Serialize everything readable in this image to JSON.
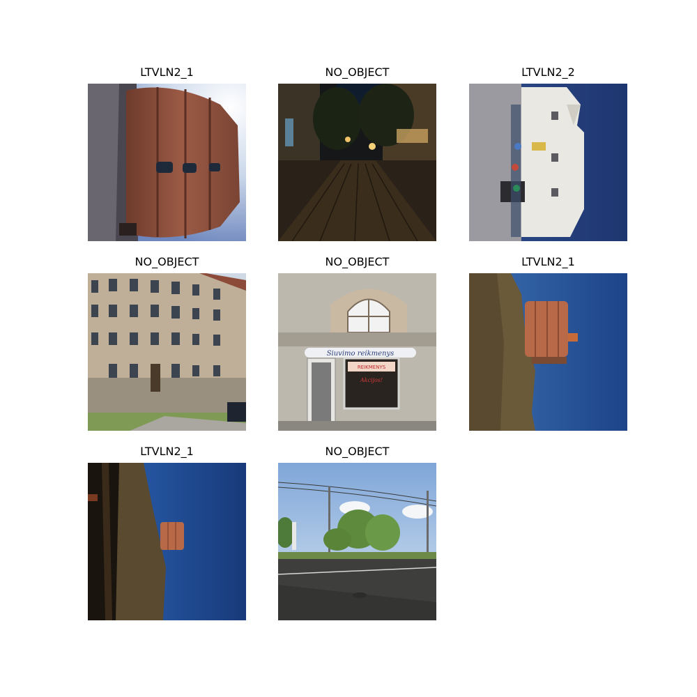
{
  "grid": {
    "cells": [
      {
        "label": "LTVLN2_1"
      },
      {
        "label": "NO_OBJECT"
      },
      {
        "label": "LTVLN2_2"
      },
      {
        "label": "NO_OBJECT"
      },
      {
        "label": "NO_OBJECT"
      },
      {
        "label": "LTVLN2_1"
      },
      {
        "label": "LTVLN2_1"
      },
      {
        "label": "NO_OBJECT"
      }
    ]
  },
  "shop_sign": {
    "line1": "Siuvimo reikmenys",
    "line2": "REIKMENYS",
    "line3": "Akcijos!"
  }
}
